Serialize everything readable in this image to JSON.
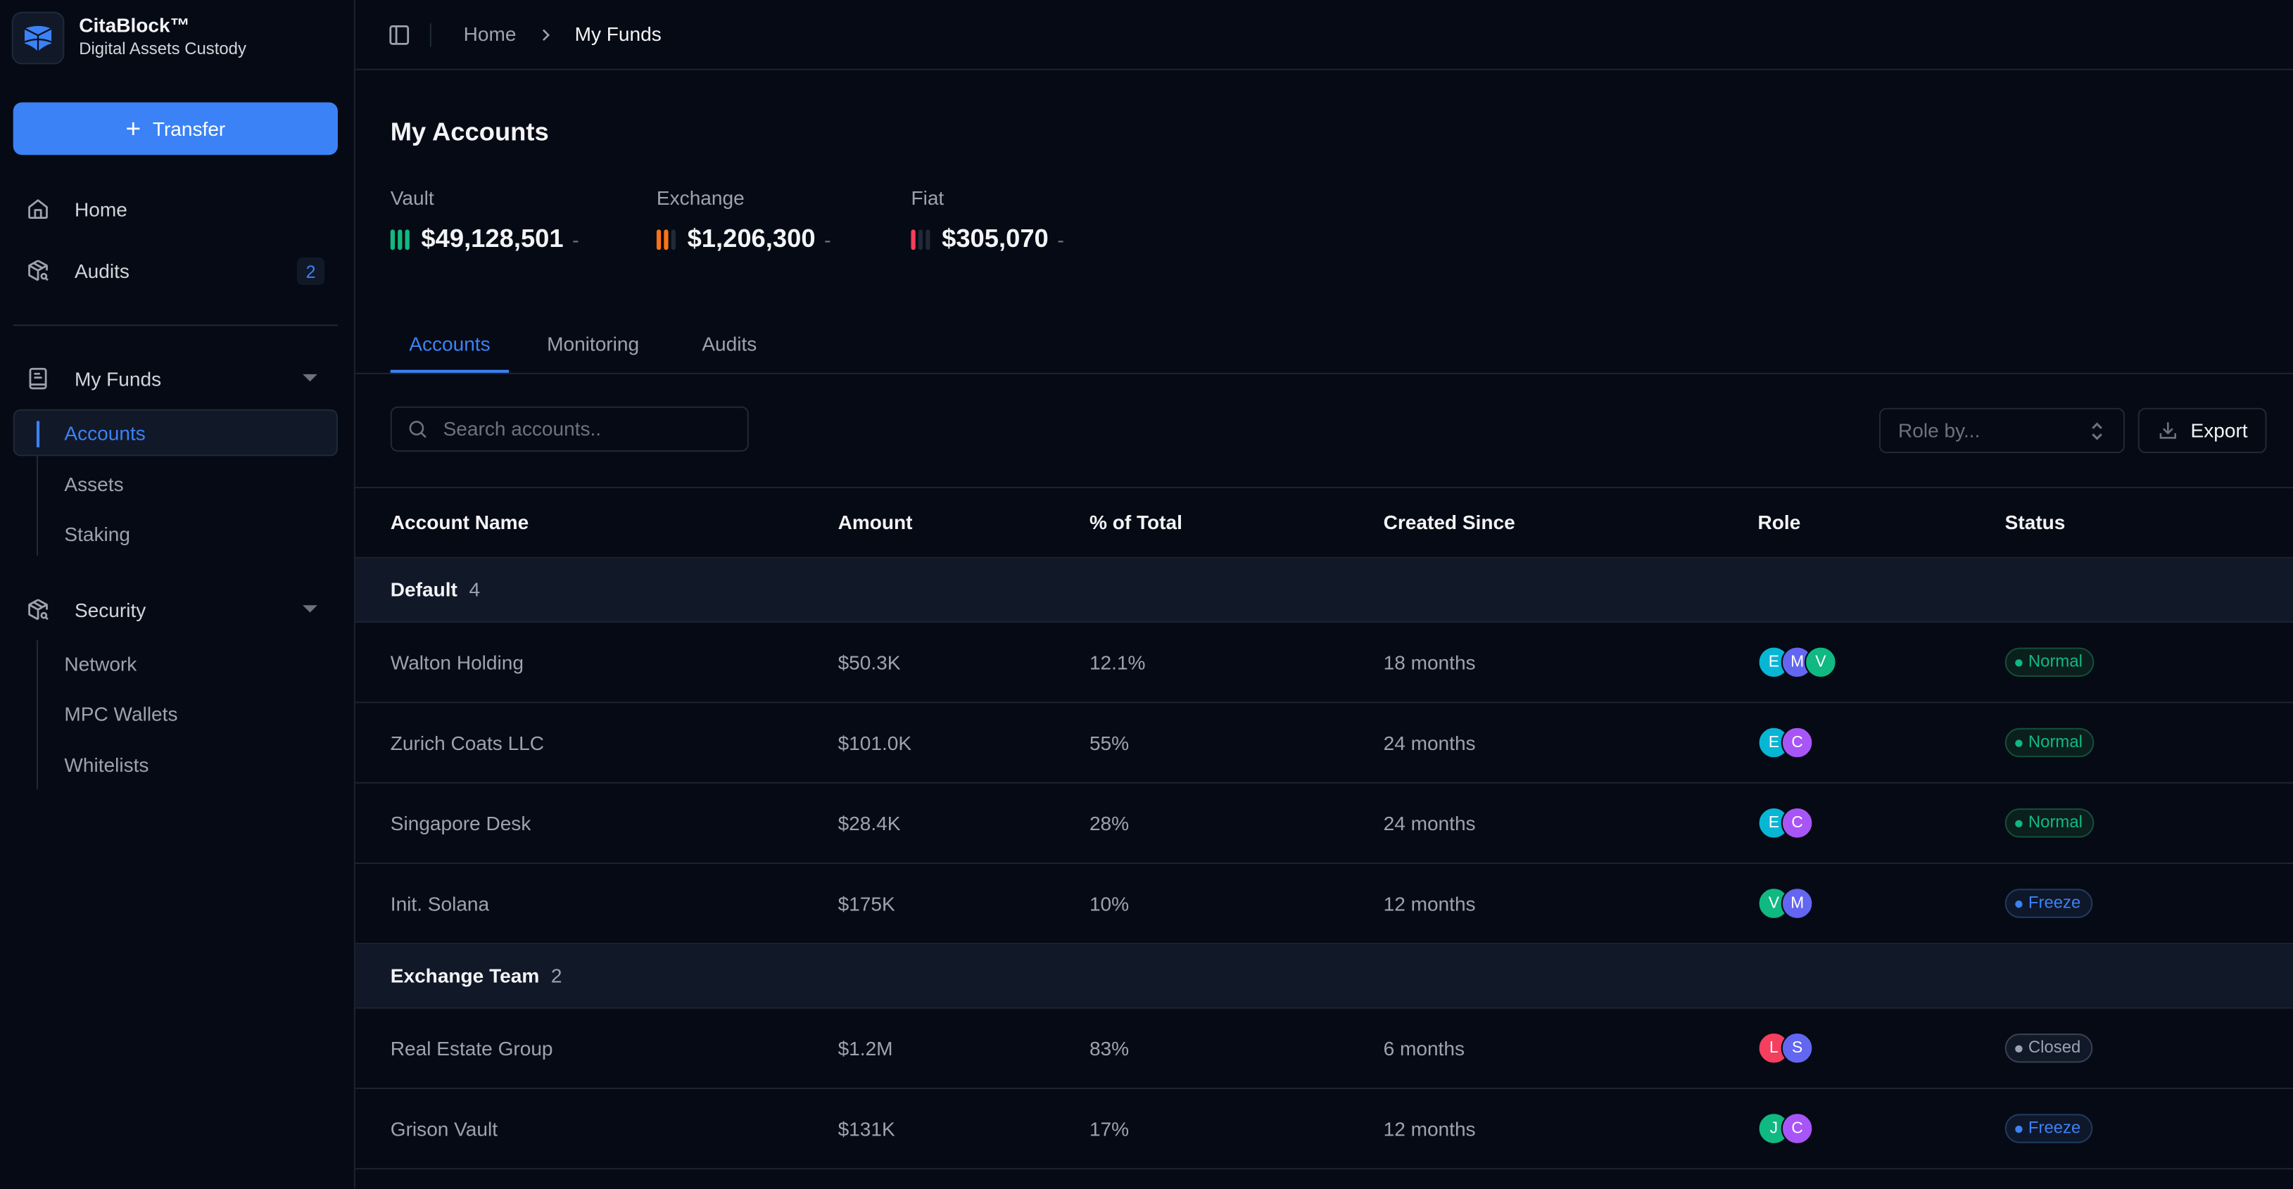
{
  "brand": {
    "name": "CitaBlock™",
    "subtitle": "Digital Assets Custody"
  },
  "sidebar": {
    "transfer_label": "Transfer",
    "items": [
      {
        "label": "Home",
        "icon": "home-icon"
      },
      {
        "label": "Audits",
        "icon": "box-search-icon",
        "badge": "2"
      }
    ],
    "groups": [
      {
        "label": "My Funds",
        "icon": "book-icon",
        "expanded": true,
        "children": [
          {
            "label": "Accounts",
            "active": true
          },
          {
            "label": "Assets"
          },
          {
            "label": "Staking"
          }
        ]
      },
      {
        "label": "Security",
        "icon": "box-search-icon",
        "expanded": true,
        "children": [
          {
            "label": "Network"
          },
          {
            "label": "MPC Wallets"
          },
          {
            "label": "Whitelists"
          }
        ]
      }
    ]
  },
  "breadcrumb": {
    "items": [
      "Home",
      "My Funds"
    ]
  },
  "page": {
    "title": "My Accounts"
  },
  "stats": [
    {
      "label": "Vault",
      "value": "$49,128,501",
      "trend": "-",
      "level": 3,
      "levels_total": 3,
      "color": "#10b981"
    },
    {
      "label": "Exchange",
      "value": "$1,206,300",
      "trend": "-",
      "level": 2,
      "levels_total": 3,
      "color": "#f97316"
    },
    {
      "label": "Fiat",
      "value": "$305,070",
      "trend": "-",
      "level": 1,
      "levels_total": 3,
      "color": "#f43f5e"
    }
  ],
  "tabs": [
    {
      "label": "Accounts",
      "active": true
    },
    {
      "label": "Monitoring"
    },
    {
      "label": "Audits"
    }
  ],
  "toolbar": {
    "search_placeholder": "Search accounts..",
    "search_value": "",
    "role_placeholder": "Role by...",
    "export_label": "Export"
  },
  "table": {
    "columns": [
      "Account Name",
      "Amount",
      "% of Total",
      "Created Since",
      "Role",
      "Status"
    ],
    "groups": [
      {
        "name": "Default",
        "count": "4",
        "rows": [
          {
            "name": "Walton Holding",
            "amount": "$50.3K",
            "pct": "12.1%",
            "created": "18 months",
            "roles": [
              "E",
              "M",
              "V"
            ],
            "status": "Normal"
          },
          {
            "name": "Zurich Coats LLC",
            "amount": "$101.0K",
            "pct": "55%",
            "created": "24 months",
            "roles": [
              "E",
              "C"
            ],
            "status": "Normal"
          },
          {
            "name": "Singapore Desk",
            "amount": "$28.4K",
            "pct": "28%",
            "created": "24 months",
            "roles": [
              "E",
              "C"
            ],
            "status": "Normal"
          },
          {
            "name": "Init. Solana",
            "amount": "$175K",
            "pct": "10%",
            "created": "12 months",
            "roles": [
              "V",
              "M"
            ],
            "status": "Freeze"
          }
        ]
      },
      {
        "name": "Exchange Team",
        "count": "2",
        "rows": [
          {
            "name": "Real Estate Group",
            "amount": "$1.2M",
            "pct": "83%",
            "created": "6 months",
            "roles": [
              "L",
              "S"
            ],
            "status": "Closed"
          },
          {
            "name": "Grison Vault",
            "amount": "$131K",
            "pct": "17%",
            "created": "12 months",
            "roles": [
              "J",
              "C"
            ],
            "status": "Freeze"
          }
        ]
      }
    ]
  },
  "role_colors": {
    "E": "#06b6d4",
    "M": "#6366f1",
    "V": "#10b981",
    "C": "#a855f7",
    "L": "#f43f5e",
    "S": "#6366f1",
    "J": "#10b981"
  },
  "status_styles": {
    "Normal": {
      "color": "#10b981",
      "bg": "#0b1f1d",
      "border": "#134e3a"
    },
    "Freeze": {
      "color": "#3b82f6",
      "bg": "#0f172a",
      "border": "#1e3a5f"
    },
    "Closed": {
      "color": "#9ca3af",
      "bg": "#111827",
      "border": "#374151"
    }
  },
  "colors": {
    "accent": "#3b82f6",
    "background": "#060a14"
  }
}
